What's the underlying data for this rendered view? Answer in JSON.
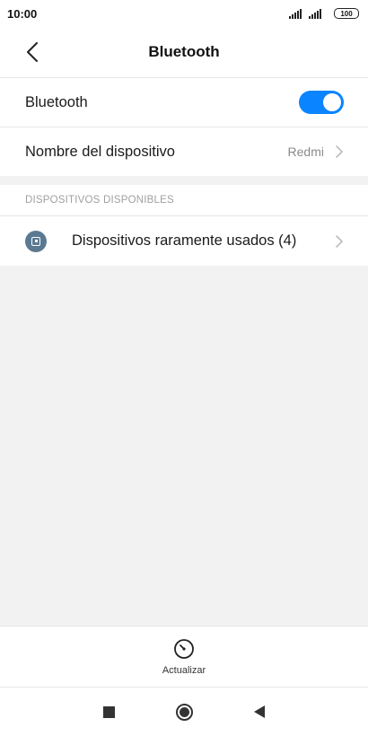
{
  "status_bar": {
    "time": "10:00",
    "battery": "100",
    "icons": [
      "signal-icon",
      "signal-icon",
      "battery-icon"
    ]
  },
  "header": {
    "title": "Bluetooth",
    "back_icon": "chevron-left-icon"
  },
  "settings": {
    "bluetooth": {
      "label": "Bluetooth",
      "enabled": true,
      "toggle_color": "#0a84ff"
    },
    "device_name": {
      "label": "Nombre del dispositivo",
      "value": "Redmi"
    }
  },
  "available": {
    "section_title": "DISPOSITIVOS DISPONIBLES",
    "items": [
      {
        "label": "Dispositivos raramente usados (4)",
        "icon": "device-icon"
      }
    ]
  },
  "bottom_action": {
    "label": "Actualizar",
    "icon": "refresh-icon"
  },
  "navigation": {
    "buttons": [
      "recents-icon",
      "home-icon",
      "back-icon"
    ]
  }
}
